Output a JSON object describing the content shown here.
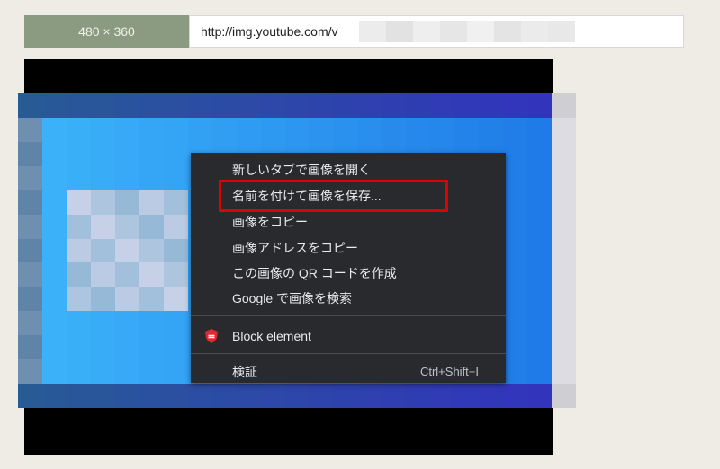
{
  "toolbar": {
    "size_label": "480 × 360",
    "url_text": "http://img.youtube.com/v"
  },
  "context_menu": {
    "items": [
      {
        "label": "新しいタブで画像を開く"
      },
      {
        "label": "名前を付けて画像を保存..."
      },
      {
        "label": "画像をコピー"
      },
      {
        "label": "画像アドレスをコピー"
      },
      {
        "label": "この画像の QR コードを作成"
      },
      {
        "label": "Google で画像を検索"
      },
      {
        "label": "Block element",
        "icon": "shield-icon"
      },
      {
        "label": "検証",
        "shortcut": "Ctrl+Shift+I"
      }
    ]
  },
  "colors": {
    "annotation": "#e00000",
    "menu_bg": "#292a2d",
    "size_label_bg": "#8b9b82"
  }
}
